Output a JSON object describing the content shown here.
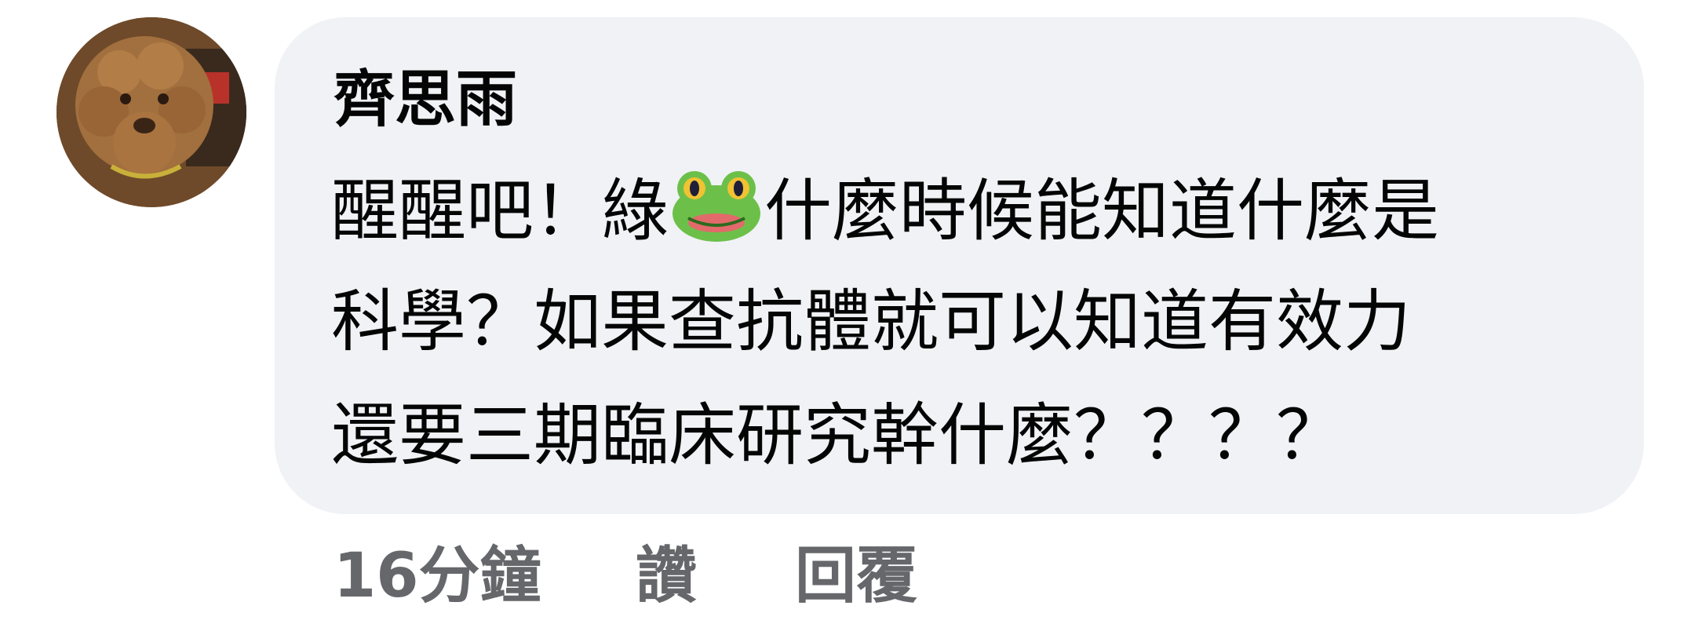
{
  "comment": {
    "author": "齊思雨",
    "text_line_1_before_emoji": "醒醒吧！綠",
    "emoji": "frog-icon",
    "text_line_1_after_emoji": "什麼時候能知道什麼是",
    "text_line_2": "科學？如果查抗體就可以知道有效力",
    "text_line_3": "還要三期臨床研究幹什麼？？？？"
  },
  "actions": {
    "timestamp": "16分鐘",
    "like_label": "讚",
    "reply_label": "回覆"
  },
  "colors": {
    "bubble_background": "#f0f2f5",
    "text_primary": "#050505",
    "text_secondary": "#65676b"
  }
}
